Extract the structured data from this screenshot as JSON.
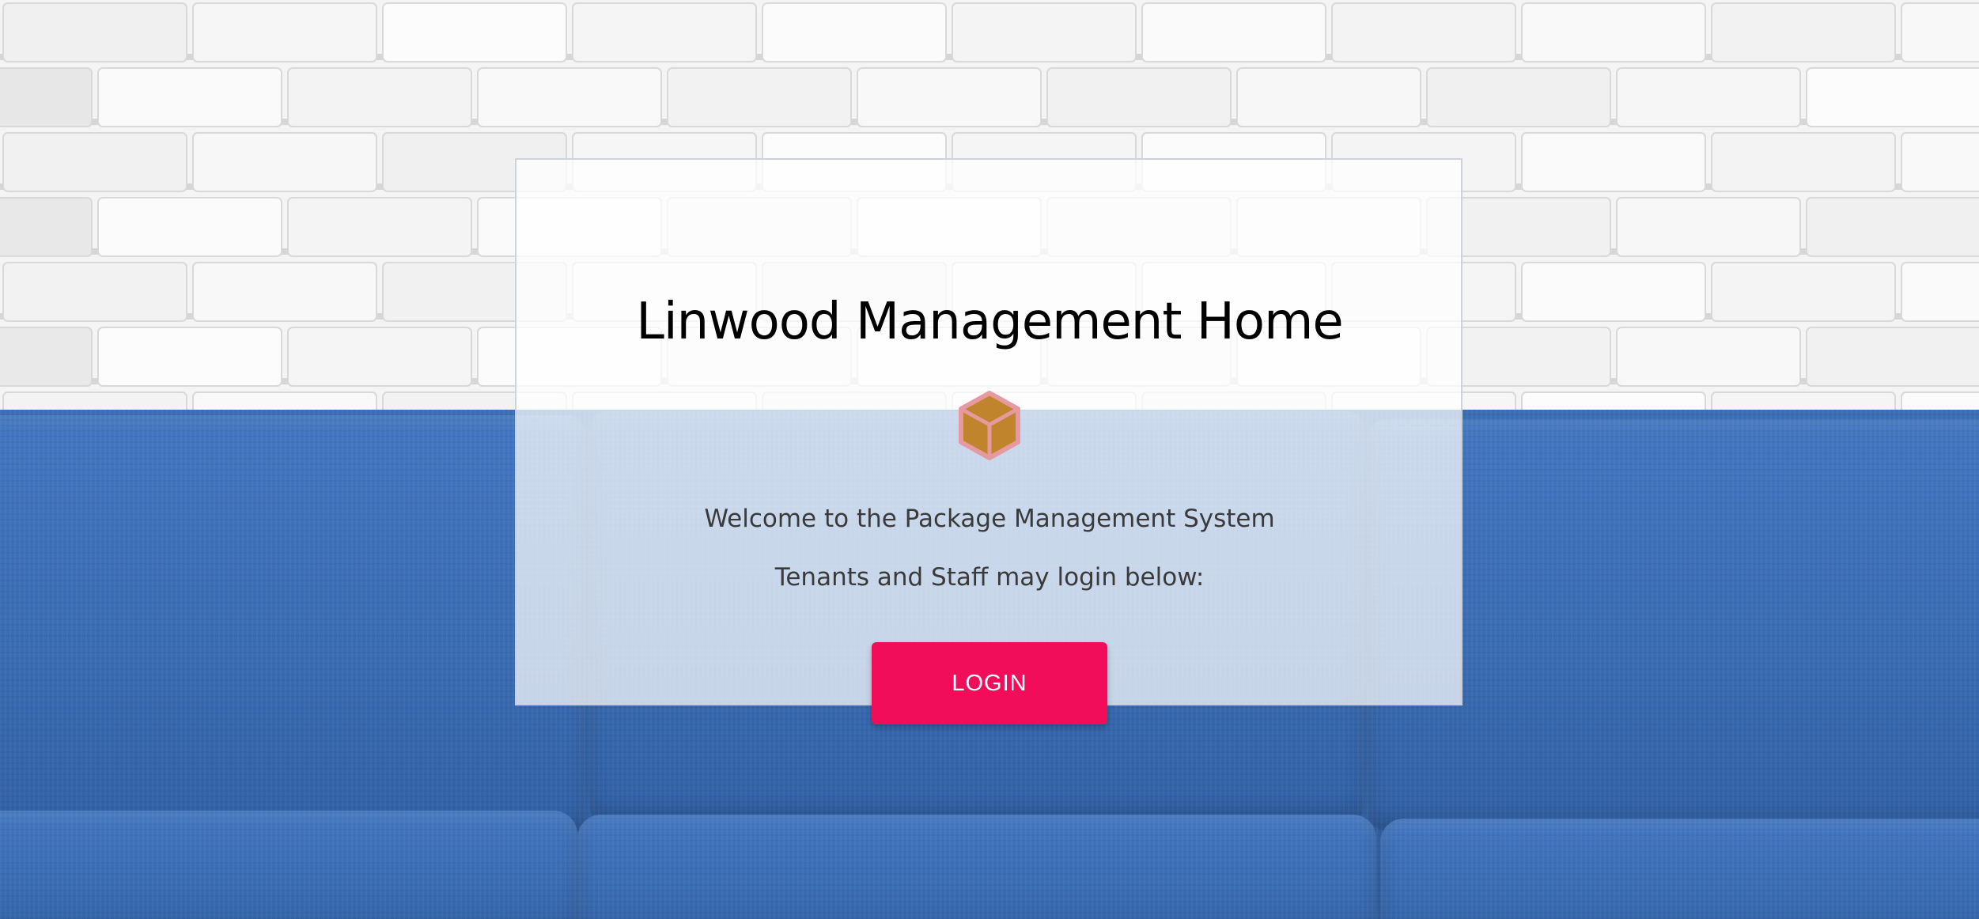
{
  "page": {
    "title": "Linwood Management Home",
    "welcome_text": "Welcome to the Package Management System",
    "instructions_text": "Tenants and Staff may login below:",
    "login_label": "LOGIN",
    "icon": "package-box-icon"
  },
  "colors": {
    "button_bg": "#f20d5a",
    "button_text": "#ffffff",
    "box_fill": "#c0852c",
    "box_outline": "#e69aa0",
    "sofa_blue": "#3a6cb3"
  }
}
